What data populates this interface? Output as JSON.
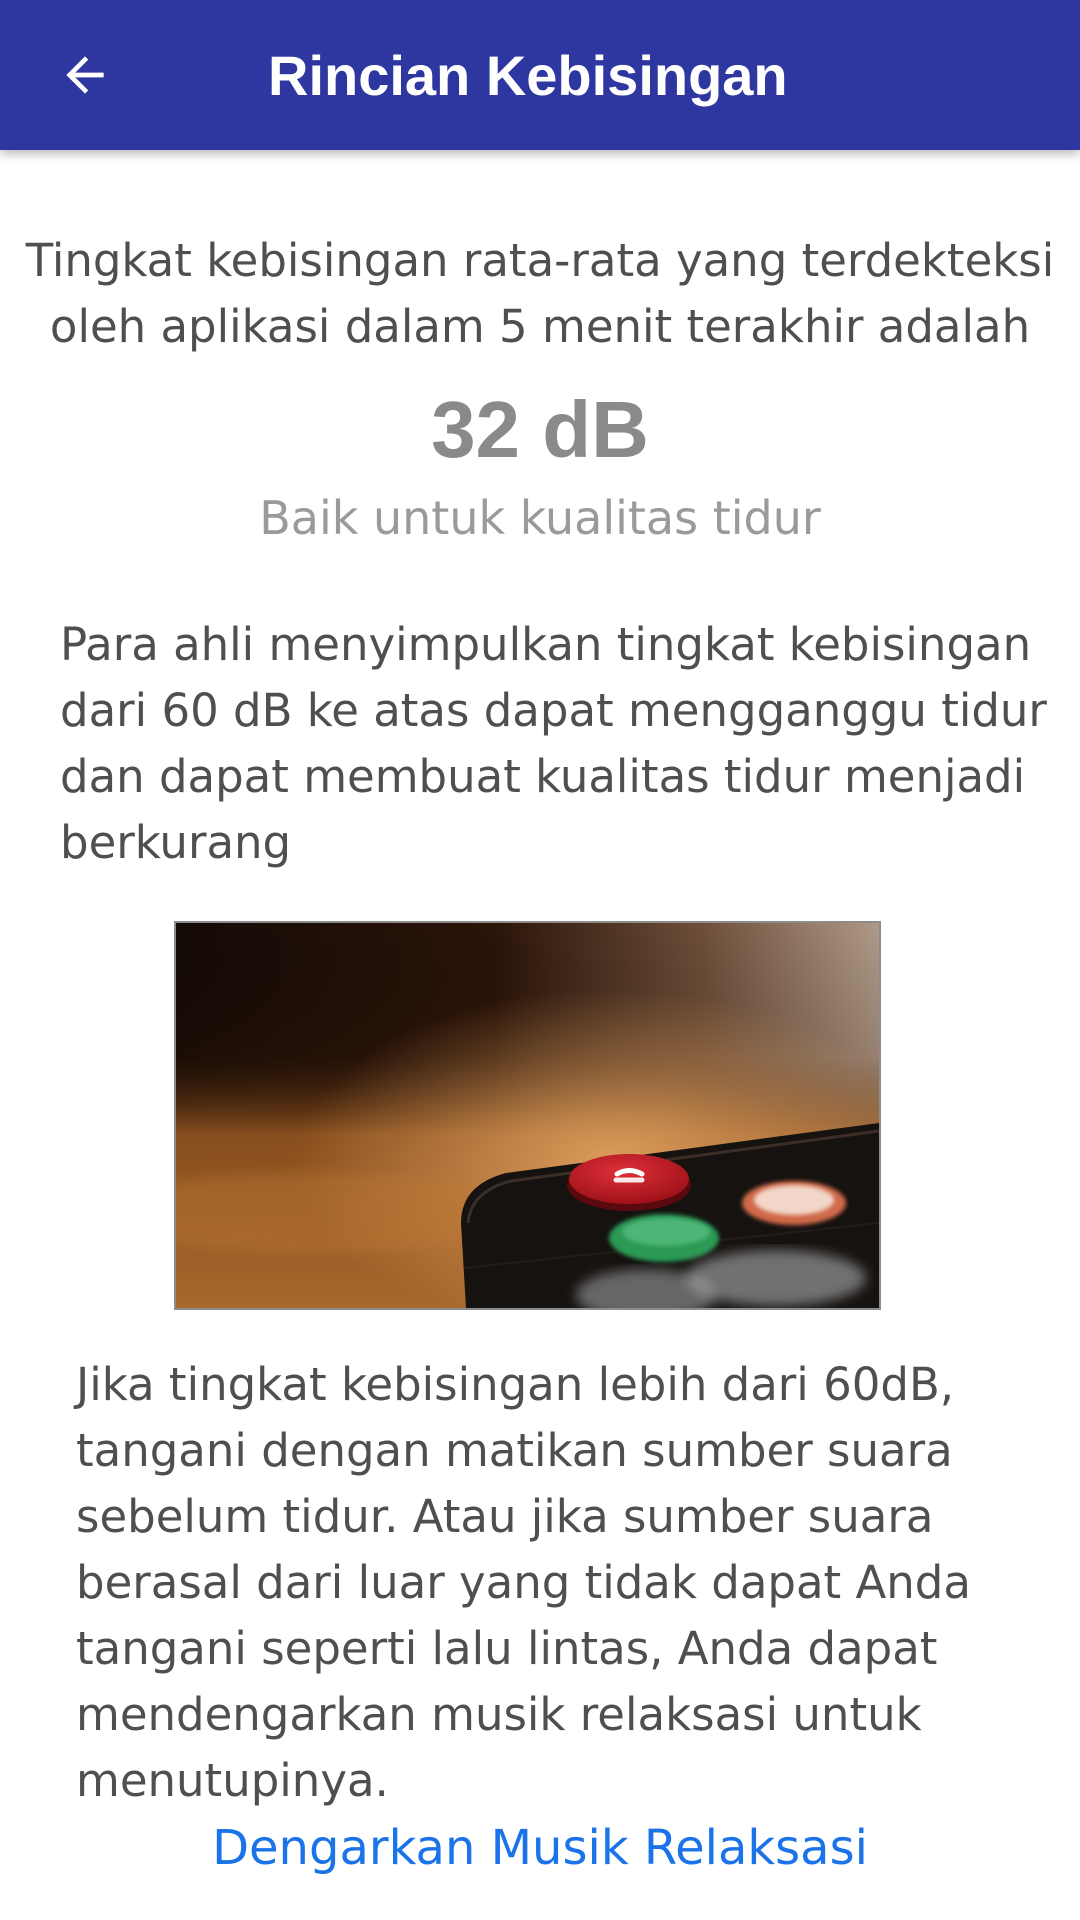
{
  "app_bar": {
    "title": "Rincian Kebisingan",
    "back_icon": "arrow-left-icon",
    "background_color": "#2e37a0"
  },
  "noise": {
    "intro": "Tingkat kebisingan rata-rata yang terdekteksi oleh aplikasi dalam 5 menit terakhir adalah",
    "value": "32 dB",
    "status": "Baik untuk kualitas tidur"
  },
  "content": {
    "expert_text": "Para ahli menyimpulkan tingkat kebisingan dari 60 dB ke atas dapat mengganggu tidur dan dapat membuat kualitas tidur menjadi berkurang",
    "image_subject": "tv-remote-power-button-photo",
    "advice_text": "Jika tingkat kebisingan lebih dari 60dB, tangani dengan matikan sumber suara sebelum tidur. Atau jika sumber suara berasal dari luar yang tidak dapat Anda tangani seperti lalu lintas, Anda dapat mendengarkan musik relaksasi untuk menutupinya.",
    "link_label": "Dengarkan Musik Relaksasi",
    "link_color": "#1a73e8"
  }
}
